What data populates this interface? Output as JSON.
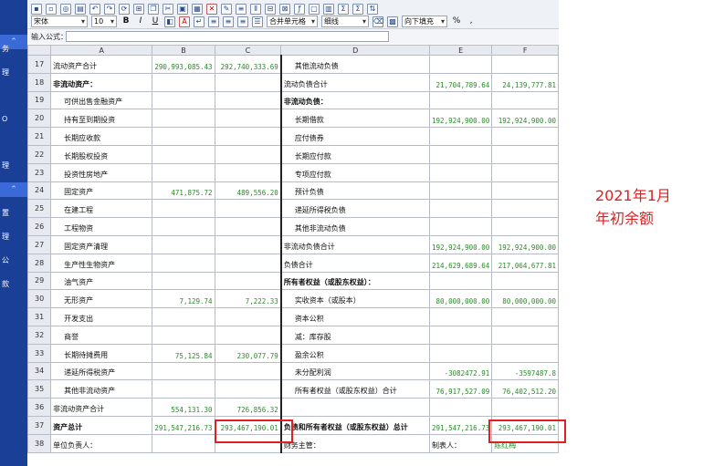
{
  "sidebar": {
    "items": [
      "务",
      "理",
      "O",
      "理",
      "置",
      "理",
      "公",
      "款"
    ]
  },
  "toolbar": {
    "font_name": "宋体",
    "font_size": "10",
    "bold": "B",
    "italic": "I",
    "underline": "U",
    "merge_label": "合并单元格",
    "border_label": "细线",
    "fill_label": "向下填充",
    "percent": "%",
    "comma": ","
  },
  "formula_bar": {
    "label": "输入公式：",
    "value": ""
  },
  "columns": [
    "A",
    "B",
    "C",
    "D",
    "E",
    "F"
  ],
  "rows": [
    {
      "n": "17",
      "a": "流动资产合计",
      "b": "290,993,085.43",
      "c": "292,740,333.69",
      "d": "其他流动负债",
      "e": "",
      "f": ""
    },
    {
      "n": "18",
      "a": "非流动资产：",
      "b": "",
      "c": "",
      "d": "流动负债合计",
      "e": "21,704,789.64",
      "f": "24,139,777.81"
    },
    {
      "n": "19",
      "a": "可供出售金融资产",
      "b": "",
      "c": "",
      "d": "非流动负债：",
      "e": "",
      "f": ""
    },
    {
      "n": "20",
      "a": "持有至到期投资",
      "b": "",
      "c": "",
      "d": "长期借款",
      "e": "192,924,900.00",
      "f": "192,924,900.00"
    },
    {
      "n": "21",
      "a": "长期应收款",
      "b": "",
      "c": "",
      "d": "应付债券",
      "e": "",
      "f": ""
    },
    {
      "n": "22",
      "a": "长期股权投资",
      "b": "",
      "c": "",
      "d": "长期应付款",
      "e": "",
      "f": ""
    },
    {
      "n": "23",
      "a": "投资性房地产",
      "b": "",
      "c": "",
      "d": "专项应付款",
      "e": "",
      "f": ""
    },
    {
      "n": "24",
      "a": "固定资产",
      "b": "471,875.72",
      "c": "489,556.20",
      "d": "预计负债",
      "e": "",
      "f": ""
    },
    {
      "n": "25",
      "a": "在建工程",
      "b": "",
      "c": "",
      "d": "递延所得税负债",
      "e": "",
      "f": ""
    },
    {
      "n": "26",
      "a": "工程物资",
      "b": "",
      "c": "",
      "d": "其他非流动负债",
      "e": "",
      "f": ""
    },
    {
      "n": "27",
      "a": "固定资产清理",
      "b": "",
      "c": "",
      "d": "非流动负债合计",
      "e": "192,924,900.00",
      "f": "192,924,900.00"
    },
    {
      "n": "28",
      "a": "生产性生物资产",
      "b": "",
      "c": "",
      "d": "负债合计",
      "e": "214,629,689.64",
      "f": "217,064,677.81"
    },
    {
      "n": "29",
      "a": "油气资产",
      "b": "",
      "c": "",
      "d": "所有者权益（或股东权益）：",
      "e": "",
      "f": ""
    },
    {
      "n": "30",
      "a": "无形资产",
      "b": "7,129.74",
      "c": "7,222.33",
      "d": "实收资本（或股本）",
      "e": "80,000,000.00",
      "f": "80,000,000.00"
    },
    {
      "n": "31",
      "a": "开发支出",
      "b": "",
      "c": "",
      "d": "资本公积",
      "e": "",
      "f": ""
    },
    {
      "n": "32",
      "a": "商誉",
      "b": "",
      "c": "",
      "d": "减：库存股",
      "e": "",
      "f": ""
    },
    {
      "n": "33",
      "a": "长期待摊费用",
      "b": "75,125.84",
      "c": "230,077.79",
      "d": "盈余公积",
      "e": "",
      "f": ""
    },
    {
      "n": "34",
      "a": "递延所得税资产",
      "b": "",
      "c": "",
      "d": "未分配利润",
      "e": "-3082472.91",
      "f": "-3597487.8"
    },
    {
      "n": "35",
      "a": "其他非流动资产",
      "b": "",
      "c": "",
      "d": "所有者权益（或股东权益）合计",
      "e": "76,917,527.09",
      "f": "76,402,512.20"
    },
    {
      "n": "36",
      "a": "非流动资产合计",
      "b": "554,131.30",
      "c": "726,856.32",
      "d": "",
      "e": "",
      "f": ""
    },
    {
      "n": "37",
      "a": "资产总计",
      "b": "291,547,216.73",
      "c": "293,467,190.01",
      "d": "负债和所有者权益（或股东权益）总计",
      "e": "291,547,216.73",
      "f": "293,467,190.01"
    },
    {
      "n": "38",
      "a": "单位负责人：",
      "b": "",
      "c": "",
      "d": "财务主管：",
      "e": "制表人：",
      "f": "陈红梅"
    }
  ],
  "annotation": {
    "line1": "2021年1月",
    "line2": "年初余额"
  },
  "colors": {
    "number_green": "#2a8a2a",
    "highlight_red": "#e02020",
    "sidebar_blue": "#1a3f96"
  }
}
